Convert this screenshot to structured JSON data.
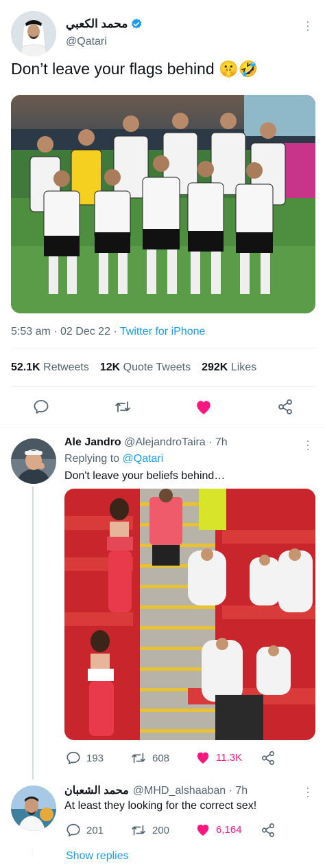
{
  "main_tweet": {
    "author_name": "محمد الكعبي",
    "handle": "@Qatari",
    "text": "Don’t leave your flags behind 🤫🤣",
    "timestamp": "5:53 am · 02 Dec 22 · ",
    "source": "Twitter for iPhone",
    "stats": {
      "retweets_count": "52.1K",
      "retweets_label": "Retweets",
      "quotes_count": "12K",
      "quotes_label": "Quote Tweets",
      "likes_count": "292K",
      "likes_label": "Likes"
    },
    "liked": true
  },
  "replies": [
    {
      "author_name": "Ale Jandro",
      "handle_time": "@AlejandroTaira · 7h",
      "replying_prefix": "Replying to ",
      "replying_handle": "@Qatari",
      "text": "Don't leave your beliefs behind…",
      "reply_count": "193",
      "retweet_count": "608",
      "like_count": "11.3K",
      "liked": true
    },
    {
      "author_name": "محمد الشعبان",
      "handle_time": "@MHD_alshaaban · 7h",
      "text": "At least they looking for the correct sex!",
      "reply_count": "201",
      "retweet_count": "200",
      "like_count": "6,164",
      "liked": true
    }
  ],
  "show_replies_label": "Show replies",
  "colors": {
    "accent": "#1d9bf0",
    "like": "#f91880",
    "text": "#0f1419",
    "secondary": "#536471",
    "divider": "#eff3f4"
  }
}
